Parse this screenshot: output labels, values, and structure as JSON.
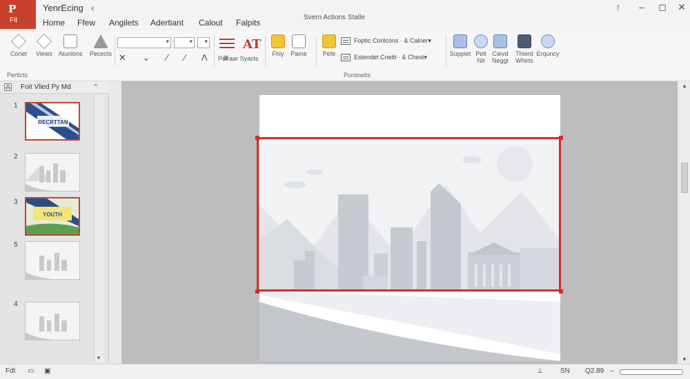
{
  "app": {
    "logo": "P",
    "file_label": "Fit",
    "doc_title": "YenrEcing",
    "center_title": "Svern Actions Stalle",
    "center_tag": ""
  },
  "tabs": [
    "Home",
    "Ffew",
    "Angilets",
    "Adertiant",
    "Calout",
    "Falpits"
  ],
  "ribbon": {
    "clipboard": {
      "buttons": [
        "Conet",
        "Views",
        "Atunlons",
        "Pecects"
      ],
      "group": "Perticts"
    },
    "font_field": "",
    "size_field": "",
    "font_buttons": [
      "Poiraar Syacts"
    ],
    "at_label": "AT",
    "paste_buttons": [
      "Fhiy",
      "Pame",
      "Pefe"
    ],
    "list_items": [
      "Foptic Corilcons  ·  & Calner▾",
      "Estendet Cneitt  ·  & Chest▾"
    ],
    "group_center": "Puntowits",
    "right_buttons": [
      "Suppiet",
      "Pelt Nit",
      "Cievd Neggt",
      "Thierd Whirts",
      "Erquncy"
    ]
  },
  "panel": {
    "title": "Foit Vlied Py Md",
    "slides": [
      "1",
      "2",
      "3",
      "5",
      "4"
    ],
    "slide1_text": "RECRTTAN",
    "slide3_text": "YOUTH"
  },
  "status": {
    "left": "Fdt",
    "right_count": "SN",
    "zoom": "Q2.89",
    "minus": "–",
    "plus": "+"
  },
  "colors": {
    "accent": "#c8402e",
    "selection": "#d22c2c"
  }
}
